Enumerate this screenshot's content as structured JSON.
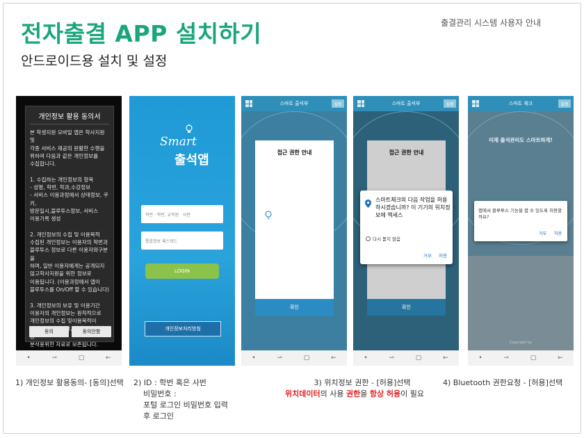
{
  "header": {
    "title": "전자출결 APP 설치하기",
    "subtitle": "안드로이드용 설치 및 설정",
    "top_right": "출결관리 시스템 사용자 안내"
  },
  "phone1": {
    "title": "개인정보 활용 동의서",
    "body": "본 학생지원 모바일 앱은 학사지원 및\n각종 서비스 제공의 원활한 수행을\n위하여 다음과 같은 개인정보를\n수집합니다.\n\n1. 수집하는 개인정보의 항목\n- 성명, 학번, 학과,수강정보\n- 서비스 이용과정에서 상태정보, 쿠키,\n방문일시,블루투스정보, 서비스\n이용기록 생성\n\n2. 개인정보의 수집 및 이용목적\n수집된 개인정보는 이용자의 학번과\n블루투스 정보로 다른 이용자와구분을\n하며, 일반 이용자에게는 공개되지\n않고학사지원을 위한 정보로\n이용됩니다. (이용과정에서 앱이\n블루투스를 On/Off 할 수 있습니다)\n\n3. 개인정보의 보유 및 이용기간\n이용자의 개인정보는 원칙적으로\n개인정보의 수집 및이용목적이\n달성되면 삭제되나, 학생들의 학사지원\n분석용위한 자료로 보존됩니다.\n\n4. 개인정보의 수집,이용,제공에 대한",
    "btn_left": "동의",
    "btn_right": "동의안함"
  },
  "phone2": {
    "logo_line1": "Smart",
    "logo_line2": "출석앱",
    "id_placeholder": "학번 · 학번, 교직원 · 사번",
    "pw_placeholder": "통합정보 패스워드",
    "login": "LOGIN",
    "privacy": "개인정보처리방침"
  },
  "phone3": {
    "header": "스마트 출석부",
    "settings": "설정",
    "dlg_title": "접근 권한 안내",
    "dlg_ok": "확인"
  },
  "phone4": {
    "header": "스마트 출석부",
    "settings": "설정",
    "dlg_title": "접근 권한 안내",
    "perm_text": "스마트체크의 다음 작업을 허용하시겠습니까? 이 기기의 위치정보에 액세스",
    "never_ask": "다시 묻지 않음",
    "deny": "거부",
    "allow": "허용",
    "dlg_ok": "확인"
  },
  "phone5": {
    "header": "스마트 체크",
    "settings": "설정",
    "banner": "이제 출석관리도 스마트하게!",
    "bt_text": "앱에서 블루투스 기능을 켤 수 있도록 허용할까요?",
    "deny": "거부",
    "allow": "허용",
    "footer": "Copyright by"
  },
  "captions": {
    "c1": "1) 개인정보 활용동의- [동의]선택",
    "c2_l1": "2) ID : 학번 혹은 사번",
    "c2_l2": "비밀번호 :",
    "c2_l3": "포털 로그인 비밀번호 입력",
    "c2_l4": "후 로그인",
    "c3_l1": "3) 위치정보 권한 - [허용]선택",
    "c3_red1": "위치데이터",
    "c3_mid1": "의 사용 ",
    "c3_red2": "권한",
    "c3_mid2": "을 ",
    "c3_red3": "항상 허용",
    "c3_end": "이 필요",
    "c4": "4) Bluetooth 권한요청 - [허용]선택"
  }
}
